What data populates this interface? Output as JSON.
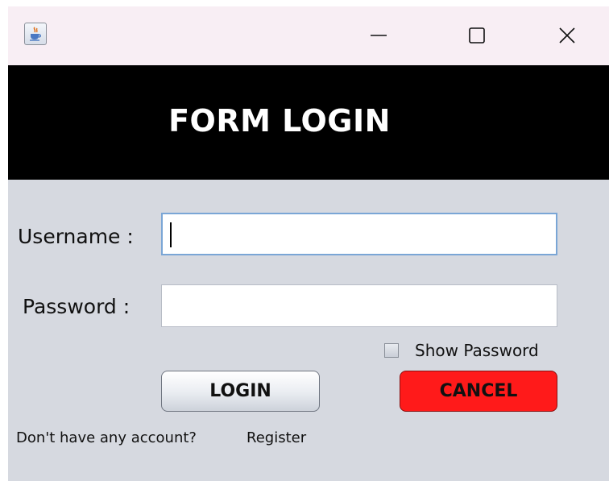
{
  "window": {
    "icon": "java-cup-icon",
    "controls": {
      "minimize": "minimize-icon",
      "maximize": "maximize-icon",
      "close": "close-icon"
    }
  },
  "banner": {
    "title": "FORM LOGIN",
    "background": "#000000",
    "text_color": "#ffffff"
  },
  "form": {
    "username_label": "Username :",
    "username_value": "",
    "password_label": "Password :",
    "password_value": "",
    "show_password_label": "Show Password",
    "show_password_checked": false
  },
  "buttons": {
    "login_label": "LOGIN",
    "cancel_label": "CANCEL",
    "cancel_color": "#ff1a1a"
  },
  "footer": {
    "question": "Don't have any account?",
    "register_label": "Register"
  }
}
